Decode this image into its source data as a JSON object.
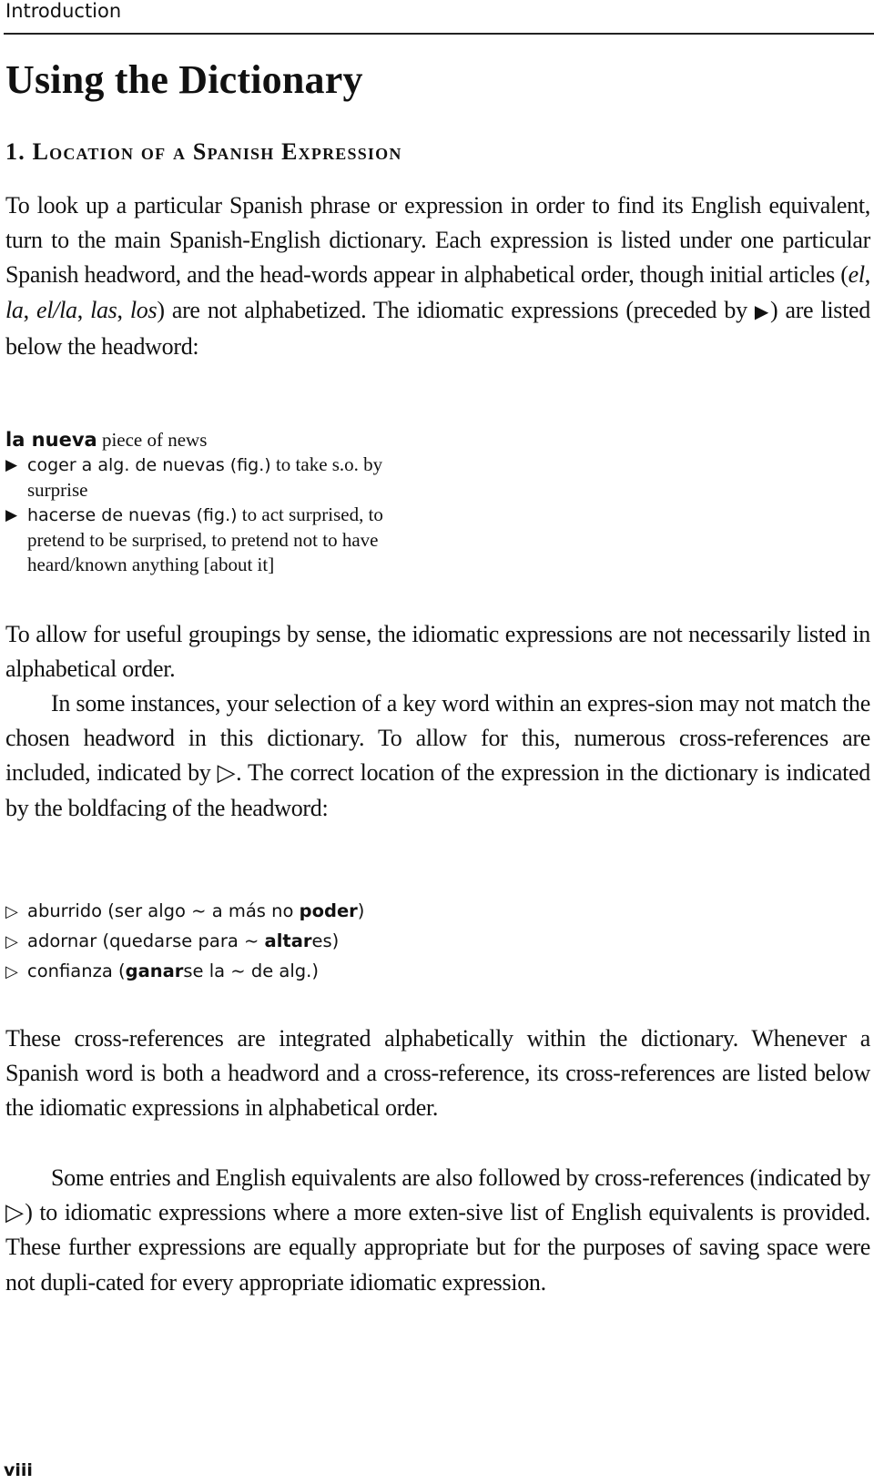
{
  "running_head": "Introduction",
  "title": "Using the Dictionary",
  "section_heading": "1. Location of a Spanish Expression",
  "icons": {
    "idiom_marker": "▶",
    "cross_reference_marker": "▷"
  },
  "intro_paragraph": {
    "part1": "To look up a particular Spanish phrase or expression in order to find its English equivalent, turn to the main Spanish-English dictionary. Each expression is listed under one particular Spanish headword, and the head-words appear in alphabetical order, though initial articles (",
    "art1": "el",
    "sep1": ", ",
    "art2": "la",
    "sep2": ", ",
    "art3": "el/la",
    "sep3": ", ",
    "art4": "las",
    "sep4": ", ",
    "art5": "los",
    "part2": ") are not alphabetized. The idiomatic expressions (preceded by ",
    "part3": ") are listed below the headword:"
  },
  "example_entry": {
    "headword": "la nueva",
    "definition": "piece of news",
    "idioms": [
      {
        "spanish": "coger a alg. de nuevas (fig.)",
        "english": "to take s.o. by surprise"
      },
      {
        "spanish": "hacerse de nuevas (fig.)",
        "english": "to act surprised, to pretend to be surprised, to pretend not to have heard/known anything [about it]"
      }
    ]
  },
  "paragraph_grouping": "To allow for useful groupings by sense, the idiomatic expressions are not necessarily listed in alphabetical order.",
  "paragraph_keyword": {
    "part1": "In some instances, your selection of a key word within an expres-sion may not match the chosen headword in this dictionary. To allow for this, numerous cross-references are included, indicated by ",
    "part2": ". The correct location of the expression in the dictionary is indicated by the boldfacing of the headword:"
  },
  "cross_references": [
    {
      "word": "aburrido",
      "pre": " (ser algo ~ a más no ",
      "bold": "poder",
      "post": ")"
    },
    {
      "word": "adornar",
      "pre": " (quedarse para ~ ",
      "bold": "altar",
      "post": "es)"
    },
    {
      "word": "confianza",
      "pre": " (",
      "bold": "ganar",
      "post": "se la ~ de alg.)"
    }
  ],
  "paragraph_integrated": "These cross-references are integrated alphabetically within the dictionary. Whenever a Spanish word is both a headword and a cross-reference, its cross-references are listed below the idiomatic expressions in alphabetical order.",
  "paragraph_equivalents": {
    "part1": "Some entries and English equivalents are also followed by cross-references (indicated by ",
    "part2": ") to idiomatic expressions where a more exten-sive list of English equivalents is provided. These further expressions are equally appropriate but for the purposes of saving space were not dupli-cated for every appropriate idiomatic expression."
  },
  "page_number": "viii"
}
